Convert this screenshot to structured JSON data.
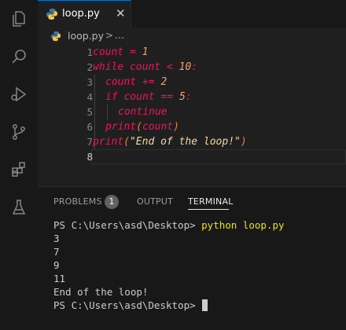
{
  "colors": {
    "accent": "#0078d4",
    "keyword": "#f0145d",
    "number": "#f0a06a",
    "string": "#f5d9a0"
  },
  "activity_bar": {
    "icons": [
      "explorer-icon",
      "search-icon",
      "debug-icon",
      "source-control-icon",
      "extensions-icon",
      "testing-icon"
    ]
  },
  "tab": {
    "label": "loop.py",
    "close": "✕"
  },
  "breadcrumb": {
    "file": "loop.py",
    "sep": ">",
    "more": "..."
  },
  "editor": {
    "line_numbers": [
      "1",
      "2",
      "3",
      "4",
      "5",
      "6",
      "7",
      "8"
    ],
    "l1": {
      "var": "count",
      "eq": " = ",
      "num": "1"
    },
    "l2": {
      "kw": "while",
      "var": " count",
      "op": " < ",
      "num": "10",
      "colon": ":"
    },
    "l3": {
      "var": "count",
      "op": " += ",
      "num": "2"
    },
    "l4": {
      "kw": "if",
      "var": " count",
      "op": " == ",
      "num": "5",
      "colon": ":"
    },
    "l5": {
      "kw": "continue"
    },
    "l6": {
      "fn": "print",
      "open": "(",
      "arg": "count",
      "close": ")"
    },
    "l7": {
      "fn": "print",
      "open": "(",
      "str": "\"End of the loop!\"",
      "close": ")"
    }
  },
  "panel": {
    "tabs": {
      "problems": "PROBLEMS",
      "problems_count": "1",
      "output": "OUTPUT",
      "terminal": "TERMINAL"
    },
    "terminal": {
      "prompt1": "PS C:\\Users\\asd\\Desktop> ",
      "command": "python loop.py",
      "out1": "3",
      "out2": "7",
      "out3": "9",
      "out4": "11",
      "out5": "End of the loop!",
      "prompt2": "PS C:\\Users\\asd\\Desktop> "
    }
  }
}
